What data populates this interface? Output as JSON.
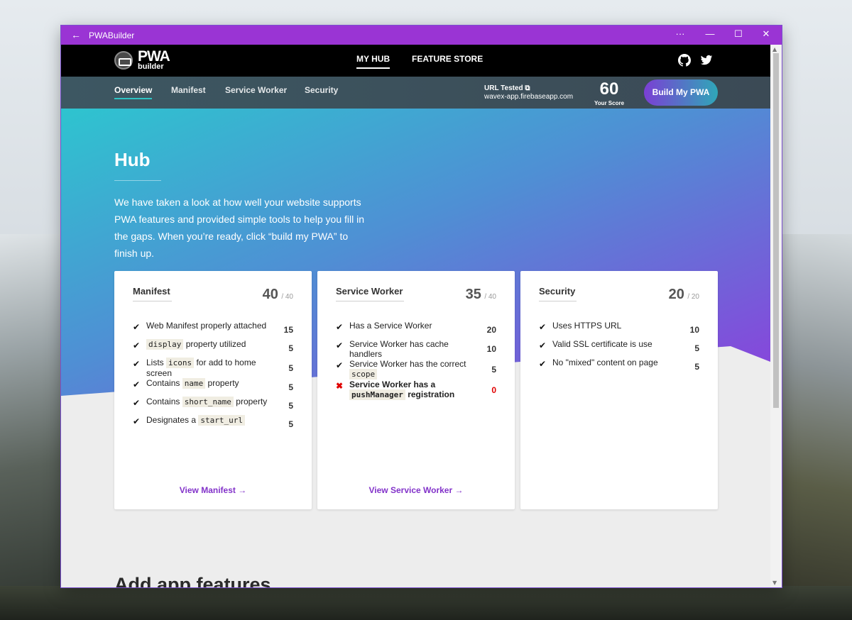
{
  "window": {
    "title": "PWABuilder"
  },
  "topnav": {
    "logo_main": "PWA",
    "logo_sub": "builder",
    "links": [
      "MY HUB",
      "FEATURE STORE"
    ],
    "icons": [
      "github-icon",
      "twitter-icon"
    ]
  },
  "subnav": {
    "tabs": [
      "Overview",
      "Manifest",
      "Service Worker",
      "Security"
    ],
    "url_label": "URL Tested",
    "url_value": "wavex-app.firebaseapp.com",
    "score": "60",
    "score_label": "Your Score",
    "build_button": "Build My PWA"
  },
  "hub": {
    "title": "Hub",
    "description": "We have taken a look at how well your website supports PWA features and provided simple tools to help you fill in the gaps. When you’re ready, click “build my PWA” to finish up."
  },
  "cards": [
    {
      "title": "Manifest",
      "score": "40",
      "max": "/ 40",
      "link": "View Manifest →",
      "items": [
        {
          "parts": [
            "Web Manifest properly attached"
          ],
          "code": [
            false
          ],
          "points": "15",
          "pass": true
        },
        {
          "parts": [
            "display",
            " property utilized"
          ],
          "code": [
            true,
            false
          ],
          "points": "5",
          "pass": true
        },
        {
          "parts": [
            "Lists ",
            "icons",
            " for add to home screen"
          ],
          "code": [
            false,
            true,
            false
          ],
          "points": "5",
          "pass": true
        },
        {
          "parts": [
            "Contains ",
            "name",
            " property"
          ],
          "code": [
            false,
            true,
            false
          ],
          "points": "5",
          "pass": true
        },
        {
          "parts": [
            "Contains ",
            "short_name",
            " property"
          ],
          "code": [
            false,
            true,
            false
          ],
          "points": "5",
          "pass": true
        },
        {
          "parts": [
            "Designates a ",
            "start_url"
          ],
          "code": [
            false,
            true
          ],
          "points": "5",
          "pass": true
        }
      ]
    },
    {
      "title": "Service Worker",
      "score": "35",
      "max": "/ 40",
      "link": "View Service Worker →",
      "items": [
        {
          "parts": [
            "Has a Service Worker"
          ],
          "code": [
            false
          ],
          "points": "20",
          "pass": true
        },
        {
          "parts": [
            "Service Worker has cache handlers"
          ],
          "code": [
            false
          ],
          "points": "10",
          "pass": true
        },
        {
          "parts": [
            "Service Worker has the correct ",
            "scope"
          ],
          "code": [
            false,
            true
          ],
          "points": "5",
          "pass": true
        },
        {
          "parts": [
            "Service Worker has a ",
            "pushManager",
            " registration"
          ],
          "code": [
            false,
            true,
            false
          ],
          "points": "0",
          "pass": false
        }
      ]
    },
    {
      "title": "Security",
      "score": "20",
      "max": "/ 20",
      "link": "",
      "items": [
        {
          "parts": [
            "Uses HTTPS URL"
          ],
          "code": [
            false
          ],
          "points": "10",
          "pass": true
        },
        {
          "parts": [
            "Valid SSL certificate is use"
          ],
          "code": [
            false
          ],
          "points": "5",
          "pass": true
        },
        {
          "parts": [
            "No \"mixed\" content on page"
          ],
          "code": [
            false
          ],
          "points": "5",
          "pass": true
        }
      ]
    }
  ],
  "section": {
    "title": "Add app features"
  },
  "colors": {
    "titlebar": "#9a34d4",
    "accent": "#8232c9",
    "gradient_start": "#2ec4cf",
    "gradient_end": "#8c3fdc",
    "fail": "#e00000"
  }
}
